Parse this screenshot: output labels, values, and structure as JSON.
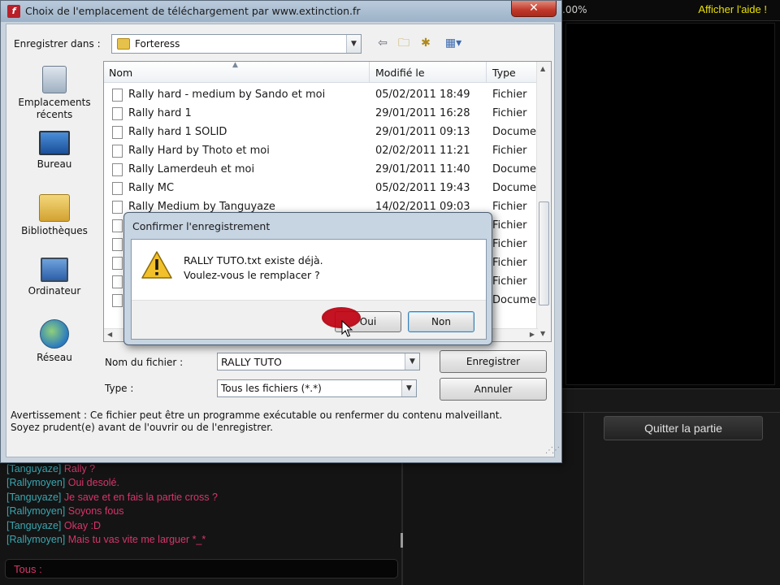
{
  "game": {
    "percent": ".00%",
    "help_link": "Afficher l'aide !",
    "quit_button": "Quitter la partie",
    "chat_channel": "Tous :",
    "chat": [
      {
        "user": "[Tanguyaze]",
        "msg": "Rally ?"
      },
      {
        "user": "[Rallymoyen]",
        "msg": "Oui desolé."
      },
      {
        "user": "[Tanguyaze]",
        "msg": "Je save et en fais la partie cross ?"
      },
      {
        "user": "[Rallymoyen]",
        "msg": "Soyons fous"
      },
      {
        "user": "[Tanguyaze]",
        "msg": "Okay :D"
      },
      {
        "user": "[Rallymoyen]",
        "msg": "Mais tu vas vite me larguer *_*"
      }
    ]
  },
  "dialog": {
    "title": "Choix de l'emplacement de téléchargement par www.extinction.fr",
    "close_glyph": "✕",
    "app_icon_glyph": "f",
    "location_label": "Enregistrer dans :",
    "location_value": "Forteress",
    "toolbar": {
      "back_glyph": "⇦",
      "up_glyph": "🗀",
      "new_folder_glyph": "✱",
      "view_glyph": "▦▾"
    },
    "places": {
      "recent": "Emplacements récents",
      "desktop": "Bureau",
      "libraries": "Bibliothèques",
      "computer": "Ordinateur",
      "network": "Réseau"
    },
    "columns": {
      "name": "Nom",
      "modified": "Modifié le",
      "type": "Type"
    },
    "files": [
      {
        "name": "Rally hard - medium by Sando et moi",
        "date": "05/02/2011 18:49",
        "type": "Fichier"
      },
      {
        "name": "Rally hard 1",
        "date": "29/01/2011 16:28",
        "type": "Fichier"
      },
      {
        "name": "Rally hard 1 SOLID",
        "date": "29/01/2011 09:13",
        "type": "Docume"
      },
      {
        "name": "Rally Hard by Thoto et moi",
        "date": "02/02/2011 11:21",
        "type": "Fichier"
      },
      {
        "name": "Rally Lamerdeuh et moi",
        "date": "29/01/2011 11:40",
        "type": "Docume"
      },
      {
        "name": "Rally MC",
        "date": "05/02/2011 19:43",
        "type": "Docume"
      },
      {
        "name": "Rally Medium by Tanguyaze",
        "date": "14/02/2011 09:03",
        "type": "Fichier"
      },
      {
        "name": "",
        "date": "",
        "type": "Fichier"
      },
      {
        "name": "",
        "date": "",
        "type": "Fichier"
      },
      {
        "name": "",
        "date": "",
        "type": "Fichier"
      },
      {
        "name": "",
        "date": "",
        "type": "Fichier"
      },
      {
        "name": "",
        "date": "",
        "type": "Docume"
      }
    ],
    "filename_label": "Nom du fichier :",
    "filename_value": "RALLY TUTO",
    "type_label": "Type :",
    "type_value": "Tous les fichiers (*.*)",
    "save_button": "Enregistrer",
    "cancel_button": "Annuler",
    "warning": "Avertissement : Ce fichier peut être un programme exécutable ou renfermer du contenu malveillant. Soyez prudent(e) avant de l'ouvrir ou de l'enregistrer."
  },
  "confirm": {
    "title": "Confirmer l'enregistrement",
    "line1": "RALLY TUTO.txt existe déjà.",
    "line2": "Voulez-vous le remplacer ?",
    "yes_button": "Oui",
    "no_button": "Non"
  },
  "colors": {
    "chat_user": "#3aa6b0",
    "chat_message": "#d8356a",
    "help_link": "#e8e000",
    "click_mark": "#c00010"
  }
}
